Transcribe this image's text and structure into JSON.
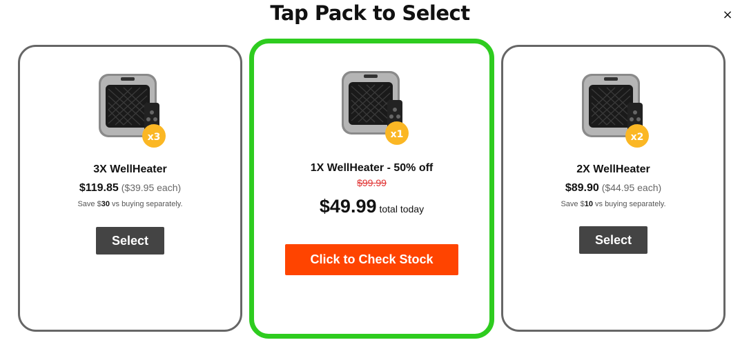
{
  "header": {
    "title": "Tap Pack to Select",
    "close_icon": "close-icon",
    "close_glyph": "×"
  },
  "colors": {
    "featured_border": "#2ecc1f",
    "card_border": "#666666",
    "cta_bg": "#ff4400",
    "select_bg": "#444444",
    "strike_price": "#e03131",
    "badge": "#fbb724"
  },
  "cards": [
    {
      "name": "3X WellHeater",
      "price": "$119.85",
      "each": "($39.95 each)",
      "save_prefix": "Save $",
      "save_amount": "30",
      "save_suffix": " vs buying separately.",
      "badge": "x3",
      "button": "Select"
    },
    {
      "name": "1X WellHeater - 50% off",
      "old_price": "$99.99",
      "price": "$49.99",
      "price_note": "total today",
      "badge": "x1",
      "button": "Click to Check Stock"
    },
    {
      "name": "2X WellHeater",
      "price": "$89.90",
      "each": "($44.95 each)",
      "save_prefix": "Save $",
      "save_amount": "10",
      "save_suffix": " vs buying separately.",
      "badge": "x2",
      "button": "Select"
    }
  ]
}
